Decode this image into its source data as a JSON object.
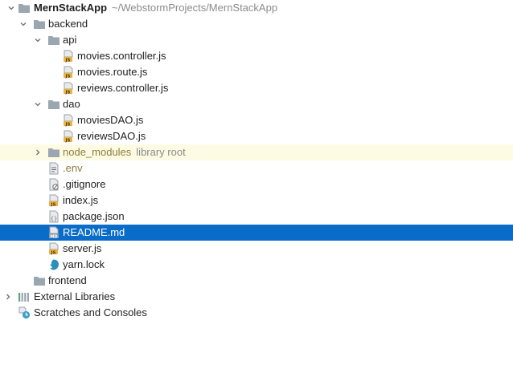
{
  "tree": {
    "root": {
      "name": "MernStackApp",
      "path": "~/WebstormProjects/MernStackApp"
    },
    "backend": {
      "label": "backend"
    },
    "api": {
      "label": "api"
    },
    "api_files": [
      "movies.controller.js",
      "movies.route.js",
      "reviews.controller.js"
    ],
    "dao": {
      "label": "dao"
    },
    "dao_files": [
      "moviesDAO.js",
      "reviewsDAO.js"
    ],
    "node_modules": {
      "label": "node_modules",
      "hint": "library root"
    },
    "backend_files": {
      "env": ".env",
      "gitignore": ".gitignore",
      "index": "index.js",
      "package": "package.json",
      "readme": "README.md",
      "server": "server.js",
      "yarn": "yarn.lock"
    },
    "frontend": {
      "label": "frontend"
    },
    "external_libraries": "External Libraries",
    "scratches": "Scratches and Consoles"
  },
  "colors": {
    "selection": "#0a6cc9",
    "folder": "#9aa7b0",
    "js_badge": "#f2b233",
    "highlight": "#fdfbe3"
  }
}
